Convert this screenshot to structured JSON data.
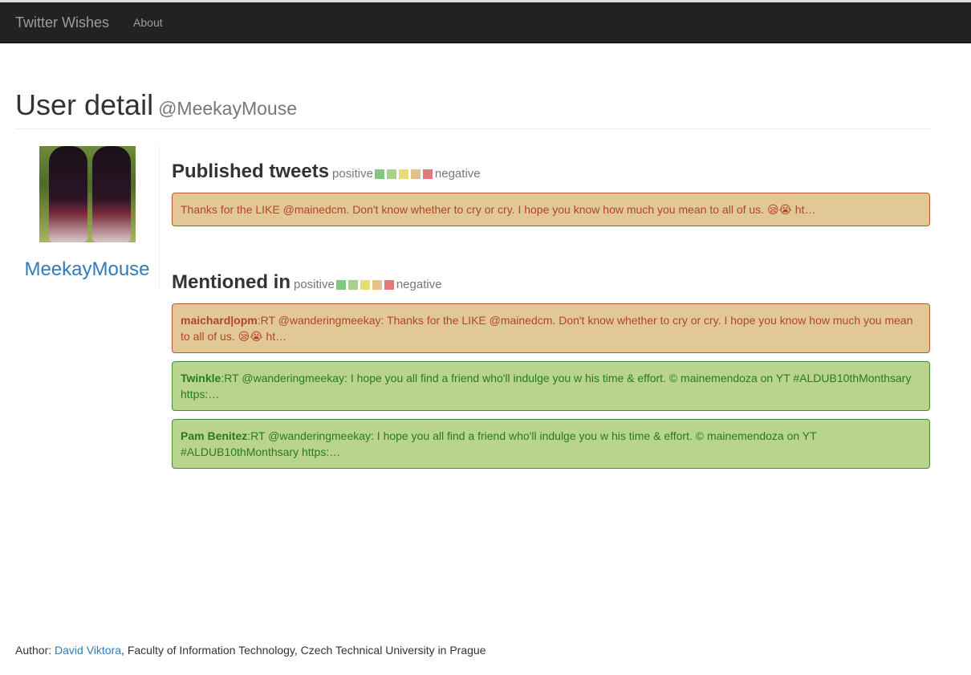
{
  "nav": {
    "brand": "Twitter Wishes",
    "about": "About"
  },
  "header": {
    "title": "User detail",
    "handle": "@MeekayMouse"
  },
  "user": {
    "name": "MeekayMouse"
  },
  "legend": {
    "positive": "positive",
    "negative": "negative",
    "colors": [
      "#7fc97f",
      "#a8d08d",
      "#e6dc7a",
      "#e3c28a",
      "#e07a7a"
    ]
  },
  "published": {
    "title": "Published tweets",
    "tweets": [
      {
        "sentiment": "negative",
        "text": "Thanks for the LIKE @mainedcm. Don't know whether to cry or cry. I hope you know how much you mean to all of us. 😪😭 ht…"
      }
    ]
  },
  "mentioned": {
    "title": "Mentioned in",
    "tweets": [
      {
        "sentiment": "negative",
        "author": "maichard|opm",
        "text": ":RT @wanderingmeekay: Thanks for the LIKE @mainedcm. Don't know whether to cry or cry. I hope you know how much you mean to all of us. 😪😭 ht…"
      },
      {
        "sentiment": "positive",
        "author": "Twinkle",
        "text": ":RT @wanderingmeekay: I hope you all find a friend who'll indulge you w his time & effort. © mainemendoza on YT #ALDUB10thMonthsary https:…"
      },
      {
        "sentiment": "positive",
        "author": "Pam Benitez",
        "text": ":RT @wanderingmeekay: I hope you all find a friend who'll indulge you w his time & effort. © mainemendoza on YT #ALDUB10thMonthsary https:…"
      }
    ]
  },
  "footer": {
    "prefix": "Author: ",
    "author": "David Viktora",
    "suffix": ", Faculty of Information Technology, Czech Technical University in Prague"
  }
}
